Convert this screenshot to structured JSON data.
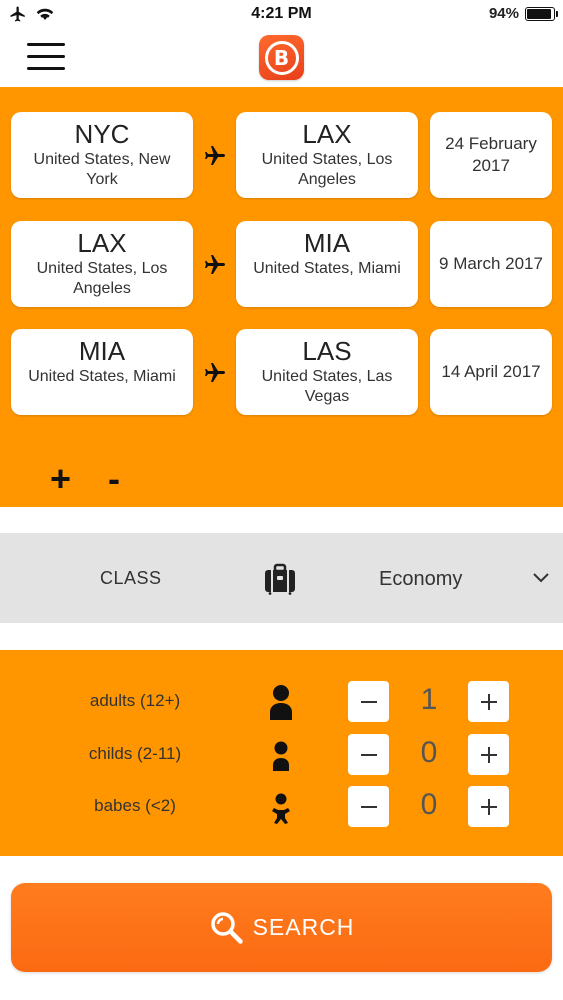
{
  "status_bar": {
    "time": "4:21 PM",
    "battery_percent": "94%",
    "battery_level": 0.94,
    "icons": [
      "airplane-mode-icon",
      "wifi-icon",
      "battery-icon"
    ]
  },
  "header": {
    "logo_letter": "B",
    "icons": [
      "hamburger-menu-icon",
      "app-logo"
    ]
  },
  "routes": [
    {
      "from_code": "NYC",
      "from_city": "United States, New York",
      "to_code": "LAX",
      "to_city": "United States, Los Angeles",
      "date": "24 February 2017"
    },
    {
      "from_code": "LAX",
      "from_city": "United States, Los Angeles",
      "to_code": "MIA",
      "to_city": "United States, Miami",
      "date": "9 March 2017"
    },
    {
      "from_code": "MIA",
      "from_city": "United States, Miami",
      "to_code": "LAS",
      "to_city": "United States, Las Vegas",
      "date": "14 April 2017"
    }
  ],
  "route_controls": {
    "add": "+",
    "remove": "-"
  },
  "class_selector": {
    "label": "CLASS",
    "value": "Economy",
    "icon": "luggage-icon"
  },
  "passengers": [
    {
      "label": "adults (12+)",
      "count": "1",
      "icon": "adult-icon"
    },
    {
      "label": "childs (2-11)",
      "count": "0",
      "icon": "child-icon"
    },
    {
      "label": "babes (<2)",
      "count": "0",
      "icon": "baby-icon"
    }
  ],
  "search": {
    "label": "SEARCH"
  },
  "colors": {
    "orange": "#ff9600",
    "search_orange": "#fb6a12",
    "class_bg": "#e3e3e3",
    "logo": "#e8401a"
  }
}
